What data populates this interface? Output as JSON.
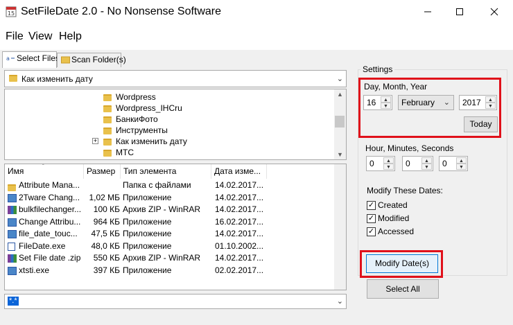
{
  "window": {
    "title": "SetFileDate 2.0 - No Nonsense Software"
  },
  "menu": [
    "File",
    "View",
    "Help"
  ],
  "tabs": [
    {
      "label": "Select Files"
    },
    {
      "label": "Scan Folder(s)"
    }
  ],
  "path_combo": {
    "value": "Как изменить дату"
  },
  "tree": [
    "Wordpress",
    "Wordpress_IHCru",
    "БанкиФото",
    "Инструменты",
    "Как изменить дату",
    "MTC"
  ],
  "list": {
    "columns": [
      "Имя",
      "Размер",
      "Тип элемента",
      "Дата изме..."
    ],
    "rows": [
      {
        "name": "Attribute Mana...",
        "size": "",
        "type": "Папка с файлами",
        "date": "14.02.2017..."
      },
      {
        "name": "2Tware Chang...",
        "size": "1,02 МБ",
        "type": "Приложение",
        "date": "14.02.2017..."
      },
      {
        "name": "bulkfilechanger...",
        "size": "100 КБ",
        "type": "Архив ZIP - WinRAR",
        "date": "14.02.2017..."
      },
      {
        "name": "Change Attribu...",
        "size": "964 КБ",
        "type": "Приложение",
        "date": "16.02.2017..."
      },
      {
        "name": "file_date_touc...",
        "size": "47,5 КБ",
        "type": "Приложение",
        "date": "14.02.2017..."
      },
      {
        "name": "FileDate.exe",
        "size": "48,0 КБ",
        "type": "Приложение",
        "date": "01.10.2002..."
      },
      {
        "name": "Set File date .zip",
        "size": "550 КБ",
        "type": "Архив ZIP - WinRAR",
        "date": "14.02.2017..."
      },
      {
        "name": "xtsti.exe",
        "size": "397 КБ",
        "type": "Приложение",
        "date": "02.02.2017..."
      }
    ]
  },
  "filter": {
    "value": "*.*"
  },
  "settings": {
    "group_label": "Settings",
    "date_label": "Day, Month, Year",
    "day": "16",
    "month": "February",
    "year": "2017",
    "today_button": "Today",
    "time_label": "Hour, Minutes, Seconds",
    "hour": "0",
    "minute": "0",
    "second": "0",
    "modify_label": "Modify These Dates:",
    "checkboxes": [
      {
        "label": "Created",
        "checked": true
      },
      {
        "label": "Modified",
        "checked": true
      },
      {
        "label": "Accessed",
        "checked": true
      }
    ]
  },
  "buttons": {
    "modify": "Modify Date(s)",
    "select_all": "Select All"
  },
  "colors": {
    "highlight_frame": "#e0101a",
    "folder": "#e9c14c"
  }
}
